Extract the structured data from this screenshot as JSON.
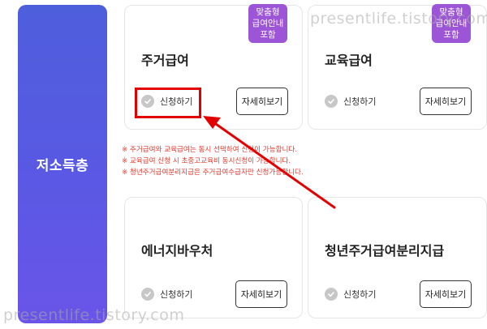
{
  "sidebar": {
    "title": "저소득층"
  },
  "cards": [
    {
      "title": "주거급여",
      "badge": [
        "맞춤형",
        "급여안내",
        "포함"
      ],
      "apply_label": "신청하기",
      "detail_label": "자세히보기"
    },
    {
      "title": "교육급여",
      "badge": [
        "맞춤형",
        "급여안내",
        "포함"
      ],
      "apply_label": "신청하기",
      "detail_label": "자세히보기"
    },
    {
      "title": "에너지바우처",
      "apply_label": "신청하기",
      "detail_label": "자세히보기"
    },
    {
      "title": "청년주거급여분리지급",
      "apply_label": "신청하기",
      "detail_label": "자세히보기"
    }
  ],
  "notes": [
    "※ 주거급여와 교육급여는 동시 선택하여 신청이 가능합니다.",
    "※ 교육급여 신청 시 초중고교육비 동시신청이 가능합니다.",
    "※ 청년주거급여분리지급은 주거급여수급자만 신청가능합니다."
  ],
  "watermarks": {
    "top": "presentlife.tistory.com",
    "bottom": "presentlife.tistory.com"
  },
  "colors": {
    "sidebar": "#5a58e4",
    "badge": "#9b55d6",
    "note": "#e33a2e",
    "highlight": "#e30000"
  }
}
